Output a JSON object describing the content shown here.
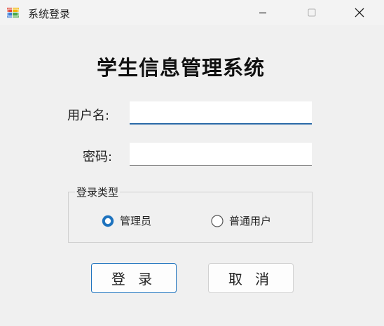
{
  "window": {
    "title": "系统登录",
    "icons": {
      "app": "app-icon",
      "minimize": "minimize-icon",
      "maximize": "maximize-icon",
      "close": "close-icon"
    }
  },
  "heading": "学生信息管理系统",
  "form": {
    "username_label": "用户名:",
    "username_value": "",
    "password_label": "密码:",
    "password_value": ""
  },
  "login_type": {
    "legend": "登录类型",
    "options": [
      {
        "label": "管理员",
        "selected": true
      },
      {
        "label": "普通用户",
        "selected": false
      }
    ]
  },
  "buttons": {
    "login": "登 录",
    "cancel": "取 消"
  },
  "colors": {
    "accent": "#1e73be",
    "background": "#f0f0f0"
  }
}
